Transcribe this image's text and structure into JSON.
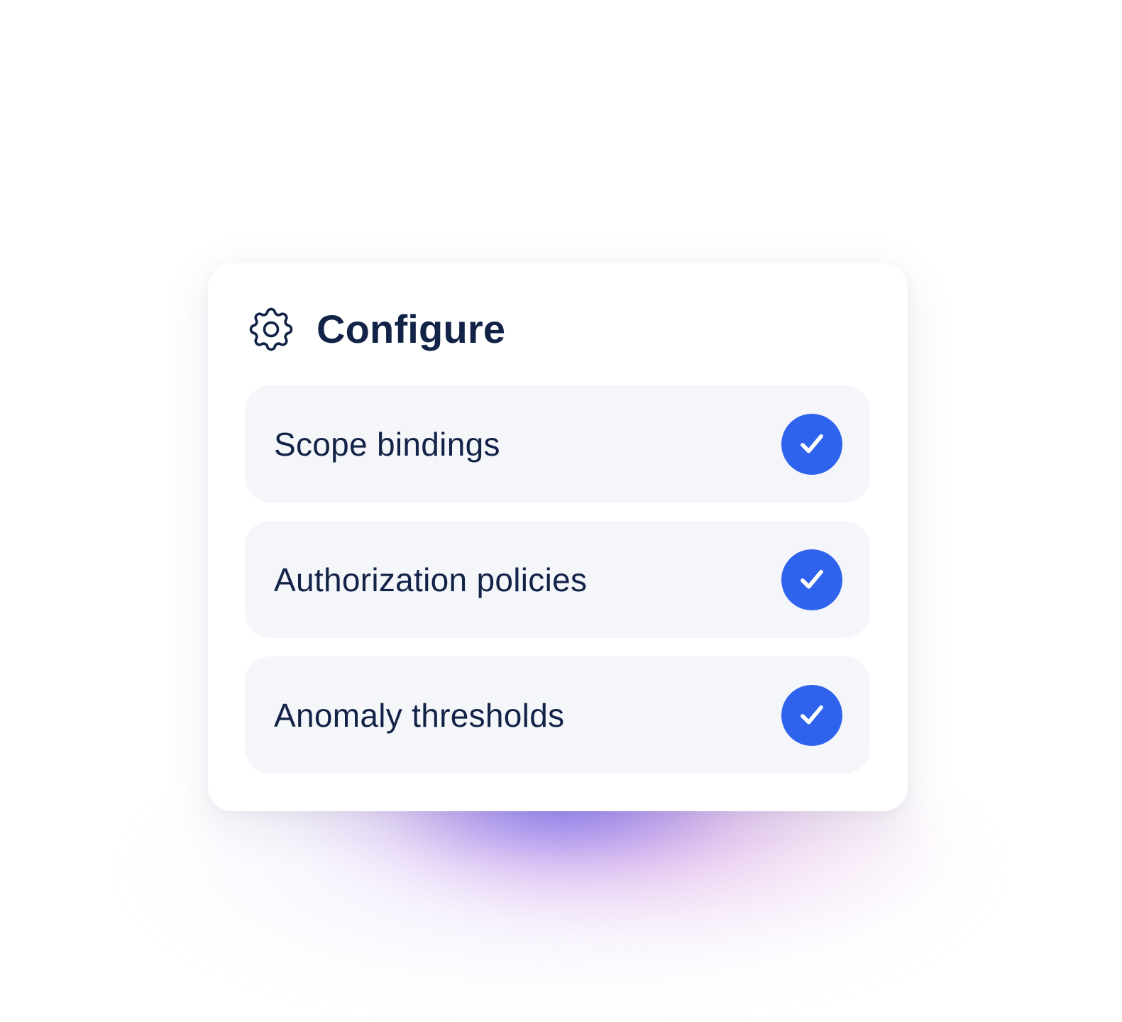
{
  "card": {
    "title": "Configure",
    "icon": "gear-icon",
    "items": [
      {
        "label": "Scope bindings",
        "checked": true,
        "icon": "check-icon"
      },
      {
        "label": "Authorization policies",
        "checked": true,
        "icon": "check-icon"
      },
      {
        "label": "Anomaly thresholds",
        "checked": true,
        "icon": "check-icon"
      }
    ]
  },
  "colors": {
    "title_text": "#132347",
    "row_background": "#f4f6fa",
    "check_accent": "#2f63ee",
    "glow_primary": "#786ef5",
    "glow_secondary": "#e696d2"
  }
}
